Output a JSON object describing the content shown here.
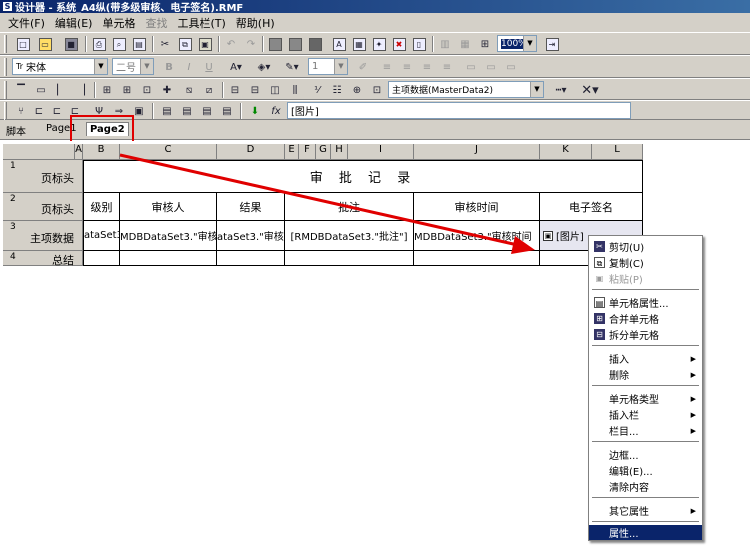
{
  "window": {
    "title": "设计器 - 系统_A4纵(带多级审核、电子签名).RMF"
  },
  "menu": [
    "文件(F)",
    "编辑(E)",
    "单元格",
    "查找",
    "工具栏(T)",
    "帮助(H)"
  ],
  "toolbar": {
    "font_name": "宋体",
    "font_size": "二号",
    "line_width": "1",
    "zoom": "100%",
    "dataset": "主项数据(MasterData2)",
    "formula_icon": "fx",
    "formula_value": "[图片]"
  },
  "tabs": [
    "脚本",
    "Page1",
    "Page2"
  ],
  "columns": [
    "A",
    "B",
    "C",
    "D",
    "E",
    "F",
    "G",
    "H",
    "I",
    "J",
    "K",
    "L"
  ],
  "rows": [
    {
      "num": "1",
      "label": "页标头"
    },
    {
      "num": "2",
      "label": "页标头"
    },
    {
      "num": "3",
      "label": "主项数据"
    },
    {
      "num": "4",
      "label": "总结"
    }
  ],
  "report": {
    "title": "审 批 记 录",
    "headers": [
      "级别",
      "审核人",
      "结果",
      "批注",
      "审核时间",
      "电子签名"
    ],
    "data": [
      "ataSet3.",
      "MDBDataSet3.\"审核人",
      "ataSet3.\"审核",
      "[RMDBDataSet3.\"批注\"]",
      "MDBDataSet3.\"审核时间",
      "[图片]"
    ]
  },
  "context_menu": [
    {
      "label": "剪切(U)",
      "icon": "scissors-icon"
    },
    {
      "label": "复制(C)",
      "icon": "copy-icon"
    },
    {
      "label": "粘贴(P)",
      "icon": "paste-icon",
      "disabled": true
    },
    {
      "label": "单元格属性...",
      "icon": "cell-properties-icon"
    },
    {
      "label": "合并单元格",
      "icon": "merge-cells-icon"
    },
    {
      "label": "拆分单元格",
      "icon": "split-cells-icon"
    },
    {
      "label": "插入",
      "submenu": true
    },
    {
      "label": "删除",
      "submenu": true
    },
    {
      "label": "单元格类型",
      "submenu": true
    },
    {
      "label": "插入栏",
      "submenu": true
    },
    {
      "label": "栏目...",
      "submenu": true
    },
    {
      "label": "边框..."
    },
    {
      "label": "编辑(E)..."
    },
    {
      "label": "清除内容"
    },
    {
      "label": "其它属性",
      "submenu": true
    },
    {
      "label": "属性...",
      "highlighted": true
    }
  ],
  "colors": {
    "highlight": "#0a246a",
    "annotation": "#e00000",
    "face": "#d4d0c8"
  }
}
